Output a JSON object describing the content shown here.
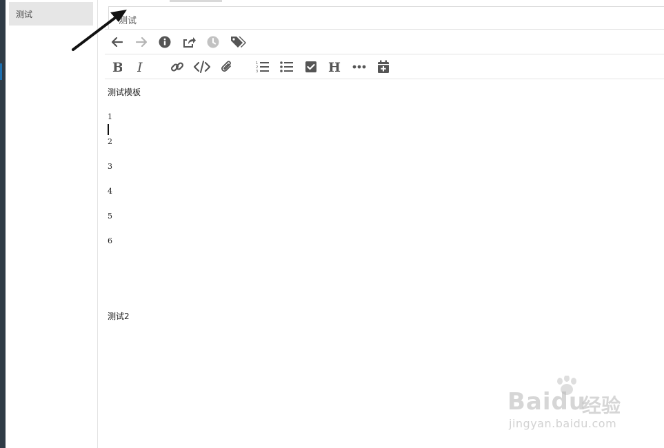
{
  "sidebar": {
    "notes": [
      {
        "title": "测试"
      }
    ]
  },
  "note": {
    "title": "测试"
  },
  "toolbar_top": {
    "icons": [
      "arrow-left-icon",
      "arrow-right-icon",
      "info-icon",
      "share-icon",
      "history-icon",
      "tags-icon"
    ]
  },
  "toolbar_format": {
    "icons": [
      "bold-icon",
      "italic-icon",
      "link-icon",
      "code-icon",
      "attachment-icon",
      "ordered-list-icon",
      "unordered-list-icon",
      "checkbox-icon",
      "heading-icon",
      "more-icon",
      "calendar-add-icon"
    ]
  },
  "editor": {
    "heading": "测试模板",
    "lines": [
      "1",
      "2",
      "3",
      "4",
      "5",
      "6"
    ],
    "footer_text": "测试2"
  },
  "watermark": {
    "brand": "Baidu",
    "brand_cn": "经验",
    "url": "jingyan.baidu.com"
  },
  "colors": {
    "icon": "#555555",
    "icon_disabled": "#b5b5b5",
    "sidebar_active": "#e6e6e6"
  }
}
